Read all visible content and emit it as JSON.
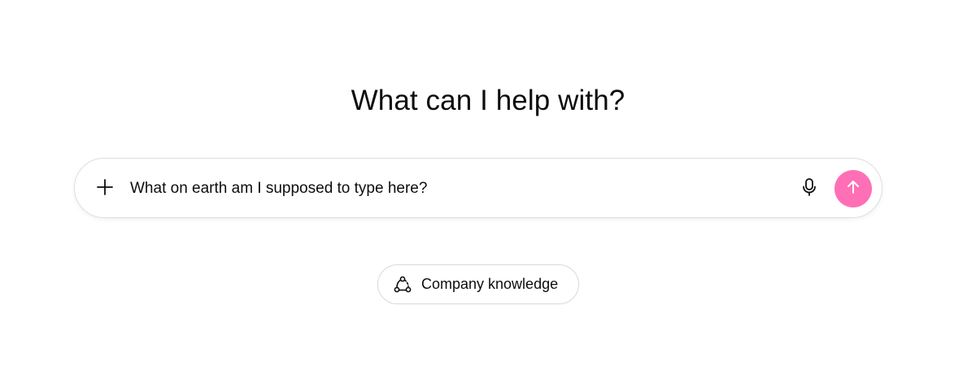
{
  "heading": "What can I help with?",
  "composer": {
    "value": "What on earth am I supposed to type here?",
    "send_color": "#ff6fb5"
  },
  "icons": {
    "add": "plus-icon",
    "voice": "microphone-icon",
    "send": "arrow-up-icon",
    "knowledge": "connected-nodes-icon"
  },
  "chips": [
    {
      "label": "Company knowledge"
    }
  ]
}
